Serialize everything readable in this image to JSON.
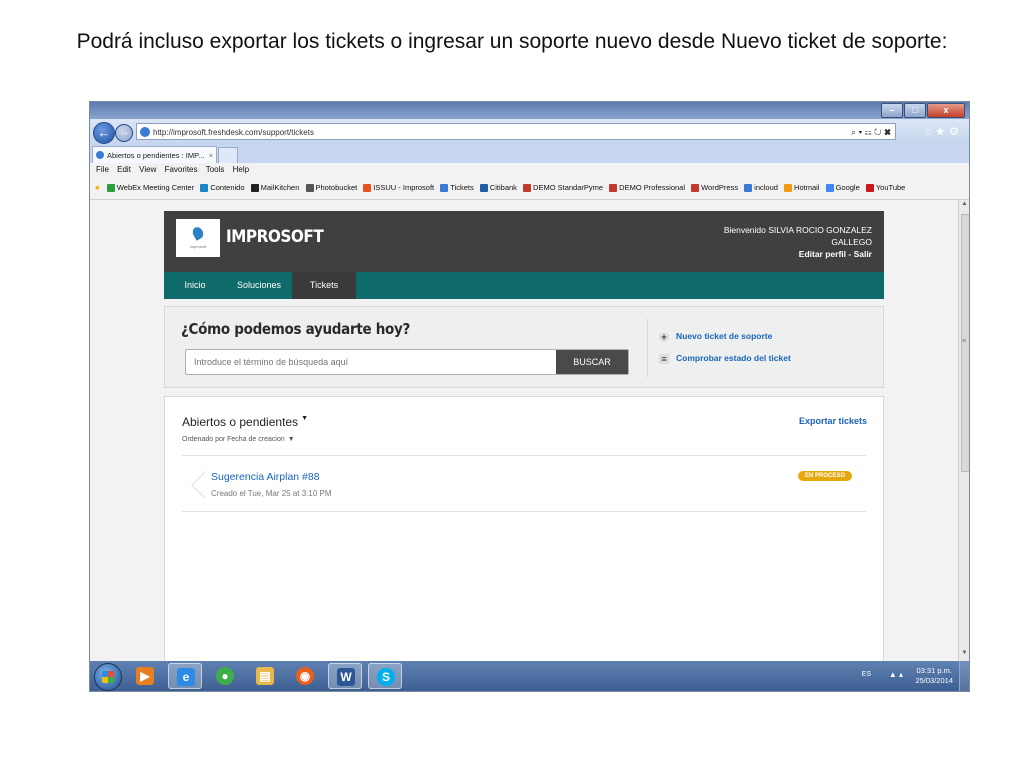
{
  "caption": "Podrá incluso exportar los tickets o ingresar un soporte nuevo desde Nuevo ticket de soporte:",
  "browser": {
    "url": "http://improsoft.freshdesk.com/support/tickets",
    "addr_tools": "⌕ ▾ ☷ ↻ ✖",
    "tab_title": "Abiertos o pendientes : IMP...",
    "menu": [
      "File",
      "Edit",
      "View",
      "Favorites",
      "Tools",
      "Help"
    ],
    "favorites": [
      {
        "label": "WebEx Meeting Center",
        "color": "#2e9e3e"
      },
      {
        "label": "Contenido",
        "color": "#1a86c8"
      },
      {
        "label": "MailKitchen",
        "color": "#222222"
      },
      {
        "label": "Photobucket",
        "color": "#555555"
      },
      {
        "label": "ISSUU - Improsoft",
        "color": "#e8511f"
      },
      {
        "label": "Tickets",
        "color": "#3a7bd5"
      },
      {
        "label": "Citibank",
        "color": "#1f5fa8"
      },
      {
        "label": "DEMO StandarPyme",
        "color": "#c0392b"
      },
      {
        "label": "DEMO Professional",
        "color": "#c0392b"
      },
      {
        "label": "WordPress",
        "color": "#c0392b"
      },
      {
        "label": "incloud",
        "color": "#3a7bd5"
      },
      {
        "label": "Hotmail",
        "color": "#f39c12"
      },
      {
        "label": "Google",
        "color": "#4285f4"
      },
      {
        "label": "YouTube",
        "color": "#cc181e"
      }
    ]
  },
  "site": {
    "brand": "IMPROSOFT",
    "logo_small": "improsoft",
    "welcome_line1": "Bienvenido SILVIA ROCIO GONZALEZ",
    "welcome_line2": "GALLEGO",
    "edit_profile": "Editar perfil - Salir",
    "nav": [
      "Inicio",
      "Soluciones",
      "Tickets"
    ],
    "help_title": "¿Cómo podemos ayudarte hoy?",
    "search_placeholder": "Introduce el término de búsqueda aquí",
    "search_button": "BUSCAR",
    "new_ticket": "Nuevo ticket de soporte",
    "check_status": "Comprobar estado del ticket",
    "open_pending": "Abiertos o pendientes",
    "sort_label": "Ordenado por Fecha de creacion",
    "export": "Exportar tickets",
    "ticket": {
      "title": "Sugerencia Airplan #88",
      "meta": "Creado el Tue, Mar 25 at 3:10 PM",
      "status": "EN PROCESO"
    }
  },
  "taskbar": {
    "apps": [
      {
        "name": "media-player-icon",
        "glyph": "▶",
        "color": "#e67e22"
      },
      {
        "name": "internet-explorer-icon",
        "glyph": "e",
        "color": "#2d8ae5",
        "active": true
      },
      {
        "name": "chrome-icon",
        "glyph": "●",
        "color": "#3fae49"
      },
      {
        "name": "file-explorer-icon",
        "glyph": "▤",
        "color": "#e8b84a"
      },
      {
        "name": "firefox-icon",
        "glyph": "◉",
        "color": "#e8601c"
      },
      {
        "name": "word-icon",
        "glyph": "W",
        "color": "#2b5797",
        "active": true
      },
      {
        "name": "skype-icon",
        "glyph": "S",
        "color": "#00aff0",
        "active": true
      }
    ],
    "lang": "ES",
    "time": "03:31 p.m.",
    "date": "25/03/2014"
  },
  "colors": {
    "header": "#404040",
    "nav": "#0f6a6a",
    "link": "#1a64b8",
    "status": "#e8a70d"
  }
}
